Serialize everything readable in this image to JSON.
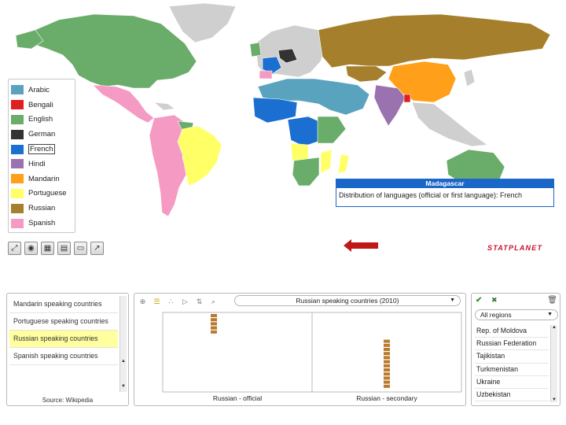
{
  "legend": {
    "items": [
      {
        "label": "Arabic",
        "color": "#5aa3bf"
      },
      {
        "label": "Bengali",
        "color": "#e02020"
      },
      {
        "label": "English",
        "color": "#6aac6a"
      },
      {
        "label": "German",
        "color": "#333333"
      },
      {
        "label": "French",
        "color": "#1a6fd0"
      },
      {
        "label": "Hindi",
        "color": "#9b72b0"
      },
      {
        "label": "Mandarin",
        "color": "#ff9f1a"
      },
      {
        "label": "Portuguese",
        "color": "#ffff66"
      },
      {
        "label": "Russian",
        "color": "#a57f2c"
      },
      {
        "label": "Spanish",
        "color": "#f59ac3"
      }
    ],
    "selected_index": 4
  },
  "colors": {
    "no_data": "#cfcfcf",
    "ocean": "#ffffff",
    "accent": "#1b66c9",
    "brand": "#c8102e"
  },
  "map_toolbar": {
    "icons": [
      "zoom-fit-icon",
      "eye-icon",
      "color-palette-icon",
      "table-icon",
      "window-icon",
      "export-icon"
    ]
  },
  "tooltip": {
    "title": "Madagascar",
    "text": "Distribution of languages (official or first language): French"
  },
  "brand": {
    "text": "STATPLANET"
  },
  "indicators": {
    "items": [
      {
        "label": "Mandarin speaking countries",
        "selected": false
      },
      {
        "label": "Portuguese speaking countries",
        "selected": false
      },
      {
        "label": "Russian speaking countries",
        "selected": true
      },
      {
        "label": "Spanish speaking countries",
        "selected": false
      }
    ],
    "source": "Source: Wikipedia"
  },
  "chart_toolbar": {
    "icons": [
      "zoom-icon",
      "bar-chart-icon",
      "scatter-icon",
      "play-icon",
      "sort-icon",
      "search-icon"
    ]
  },
  "chart_select": {
    "value": "Russian speaking countries (2010)"
  },
  "chart_data": {
    "type": "bar",
    "categories": [
      "Russian - official",
      "Russian - secondary"
    ],
    "values": [
      5,
      12
    ],
    "title": "",
    "xlabel": "",
    "ylabel": ""
  },
  "regions": {
    "selected": "All regions",
    "items": [
      "Rep. of Moldova",
      "Russian Federation",
      "Tajikistan",
      "Turkmenistan",
      "Ukraine",
      "Uzbekistan"
    ]
  }
}
